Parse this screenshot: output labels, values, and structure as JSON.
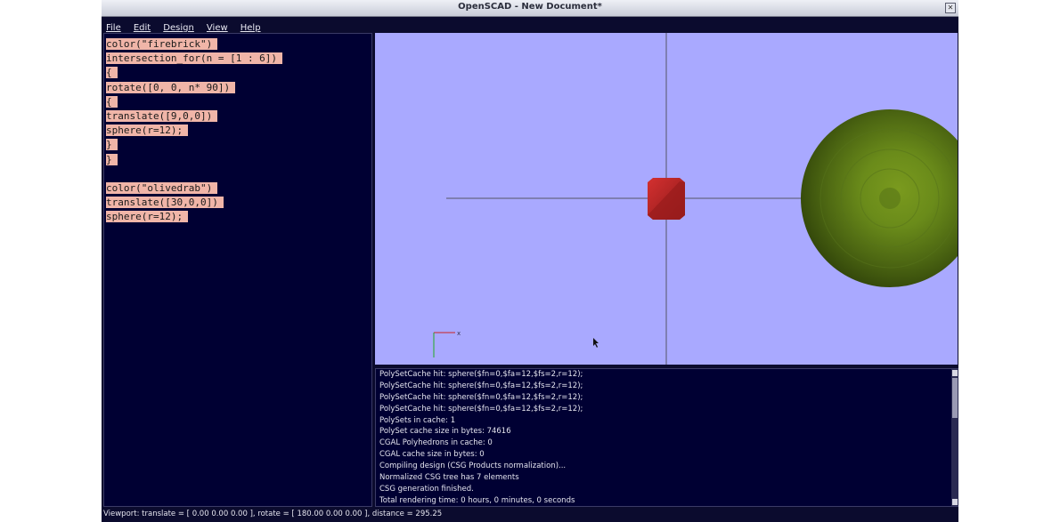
{
  "window": {
    "title": "OpenSCAD - New Document*"
  },
  "menu": [
    "File",
    "Edit",
    "Design",
    "View",
    "Help"
  ],
  "editor": {
    "lines": [
      "color(\"firebrick\")",
      "intersection_for(n = [1 : 6])",
      "{",
      "rotate([0, 0, n* 90])",
      "{",
      "translate([9,0,0])",
      "sphere(r=12);",
      "}",
      "}",
      "",
      "color(\"olivedrab\")",
      "translate([30,0,0])",
      "sphere(r=12);"
    ]
  },
  "viewport": {
    "background": "#a9a9ff",
    "axes": {
      "x_label": "x"
    },
    "objects": [
      {
        "name": "firebrick intersection",
        "color": "#b22222"
      },
      {
        "name": "olivedrab sphere",
        "color": "#6b8e23"
      }
    ]
  },
  "console": {
    "lines": [
      "PolySetCache hit: sphere($fn=0,$fa=12,$fs=2,r=12);",
      "PolySetCache hit: sphere($fn=0,$fa=12,$fs=2,r=12);",
      "PolySetCache hit: sphere($fn=0,$fa=12,$fs=2,r=12);",
      "PolySetCache hit: sphere($fn=0,$fa=12,$fs=2,r=12);",
      "PolySets in cache: 1",
      "PolySet cache size in bytes: 74616",
      "CGAL Polyhedrons in cache: 0",
      "CGAL cache size in bytes: 0",
      "Compiling design (CSG Products normalization)...",
      "Normalized CSG tree has 7 elements",
      "CSG generation finished.",
      "Total rendering time: 0 hours, 0 minutes, 0 seconds"
    ]
  },
  "status": {
    "text": "Viewport: translate = [ 0.00 0.00 0.00 ], rotate = [ 180.00 0.00 0.00 ], distance = 295.25"
  }
}
